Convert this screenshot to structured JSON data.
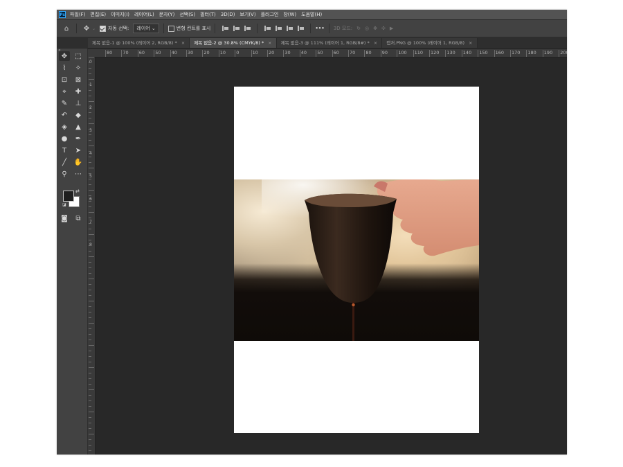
{
  "app": {
    "logo_text": "Ps"
  },
  "menu": [
    "파일(F)",
    "편집(E)",
    "이미지(I)",
    "레이어(L)",
    "문자(Y)",
    "선택(S)",
    "필터(T)",
    "3D(D)",
    "보기(V)",
    "플러그인",
    "창(W)",
    "도움말(H)"
  ],
  "options": {
    "auto_select_label": "자동 선택:",
    "auto_select_value": "레이어",
    "transform_controls_label": "변형 컨트롤 표시",
    "mode_3d_label": "3D 모드:",
    "more_label": "•••"
  },
  "tabs": [
    {
      "label": "제목 없음-1 @ 100% (레이어 2, RGB/8) *",
      "active": false
    },
    {
      "label": "제목 없음-2 @ 30.8% (CMYK/8) *",
      "active": true
    },
    {
      "label": "제목 없음-3 @ 111% (레이어 1, RGB/8#) *",
      "active": false
    },
    {
      "label": "캡처.PNG @ 100% (레이어 1, RGB/8)",
      "active": false
    }
  ],
  "ruler_h_labels": [
    "80",
    "70",
    "60",
    "50",
    "40",
    "30",
    "20",
    "10",
    "0",
    "10",
    "20",
    "30",
    "40",
    "50",
    "60",
    "70",
    "80",
    "90",
    "100",
    "110",
    "120",
    "130",
    "140",
    "150",
    "160",
    "170",
    "180",
    "190",
    "200"
  ],
  "ruler_v_labels": [
    "0",
    "1",
    "2",
    "3",
    "4",
    "5",
    "6",
    "7",
    "8"
  ],
  "colors": {
    "foreground": "#1e1e1e",
    "background": "#ffffff",
    "ui_dark": "#282828",
    "panel": "#424242"
  },
  "tools": [
    {
      "name": "move-tool-icon",
      "glyph": "✥"
    },
    {
      "name": "marquee-tool-icon",
      "glyph": "⬚"
    },
    {
      "name": "lasso-tool-icon",
      "glyph": "⌇"
    },
    {
      "name": "magic-wand-icon",
      "glyph": "✧"
    },
    {
      "name": "crop-tool-icon",
      "glyph": "⊡"
    },
    {
      "name": "frame-tool-icon",
      "glyph": "⊠"
    },
    {
      "name": "eyedropper-icon",
      "glyph": "⌖"
    },
    {
      "name": "healing-brush-icon",
      "glyph": "✚"
    },
    {
      "name": "brush-tool-icon",
      "glyph": "✎"
    },
    {
      "name": "stamp-tool-icon",
      "glyph": "⊥"
    },
    {
      "name": "history-brush-icon",
      "glyph": "↶"
    },
    {
      "name": "eraser-tool-icon",
      "glyph": "◆"
    },
    {
      "name": "paint-bucket-icon",
      "glyph": "◈"
    },
    {
      "name": "blur-tool-icon",
      "glyph": "▲"
    },
    {
      "name": "dodge-tool-icon",
      "glyph": "●"
    },
    {
      "name": "pen-tool-icon",
      "glyph": "✒"
    },
    {
      "name": "type-tool-icon",
      "glyph": "T"
    },
    {
      "name": "path-select-icon",
      "glyph": "➤"
    },
    {
      "name": "line-tool-icon",
      "glyph": "╱"
    },
    {
      "name": "hand-tool-icon",
      "glyph": "✋"
    },
    {
      "name": "zoom-tool-icon",
      "glyph": "⚲"
    },
    {
      "name": "more-tools-icon",
      "glyph": "⋯"
    }
  ]
}
